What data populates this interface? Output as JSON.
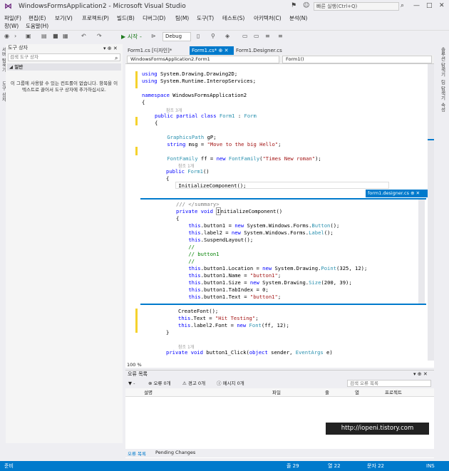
{
  "window": {
    "title": "WindowsFormsApplication2 - Microsoft Visual Studio",
    "quick_launch": "빠른 실행(Ctrl+Q)"
  },
  "menu": [
    "파일(F)",
    "편집(E)",
    "보기(V)",
    "프로젝트(P)",
    "빌드(B)",
    "디버그(D)",
    "팀(M)",
    "도구(T)",
    "테스트(S)",
    "아키텍처(C)",
    "분석(N)",
    "창(W)",
    "도움말(H)"
  ],
  "toolbar": {
    "start": "▶ 시작 -",
    "config": "Debug"
  },
  "toolbox": {
    "title": "도구 상자",
    "search_placeholder": "검색 도구 상자",
    "group": "◢ 일반",
    "empty_message": "이 그룹에 사용할 수 있는 컨트롤이 없습니다. 항목을 이 텍스트로 끌어서 도구 상자에 추가하십시오."
  },
  "left_vtabs": [
    "서버 탐색기",
    "도구 상자"
  ],
  "right_vtabs": [
    "솔루션 탐색기",
    "팀 탐색기",
    "속성"
  ],
  "tabs": [
    {
      "label": "Form1.cs [디자인]*"
    },
    {
      "label": "Form1.cs*"
    },
    {
      "label": "Form1.Designer.cs"
    }
  ],
  "nav": {
    "project": "WindowsFormsApplication2.Form1",
    "member": "Form1()"
  },
  "code_refs": [
    "참조 3개",
    "참조 1개",
    "참조 1개"
  ],
  "peek": {
    "tab": "form1.designer.cs"
  },
  "zoom": "100 %",
  "errors": {
    "title": "오류 목록",
    "counts": [
      "오류 0개",
      "경고 0개",
      "메시지 0개"
    ],
    "search": "검색 오류 목록",
    "columns": [
      "설명",
      "파일",
      "줄",
      "열",
      "프로젝트"
    ]
  },
  "bottom_tabs": [
    "오류 목록",
    "Pending Changes"
  ],
  "watermark": "http://iopeni.tistory.com",
  "status": {
    "ready": "준비",
    "line": "줄 29",
    "col": "열 22",
    "ch": "문자 22",
    "mode": "INS"
  }
}
